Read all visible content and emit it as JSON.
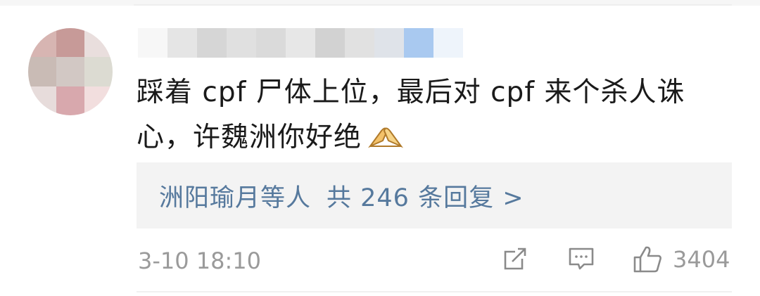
{
  "comment": {
    "text": "踩着 cpf 尸体上位，最后对 cpf 来个杀人诛心，许魏洲你好绝",
    "emoji": "pray-hands-emoji"
  },
  "replies": {
    "names": "洲阳瑜月等人",
    "summary": "共 246 条回复 >"
  },
  "footer": {
    "timestamp": "3-10 18:10",
    "like_count": "3404"
  },
  "icons": {
    "share": "share-icon",
    "comment": "comment-icon",
    "like": "thumbs-up-icon"
  },
  "colors": {
    "link": "#56799d",
    "meta": "#9a9a9a",
    "reply_bg": "#f3f3f3"
  }
}
